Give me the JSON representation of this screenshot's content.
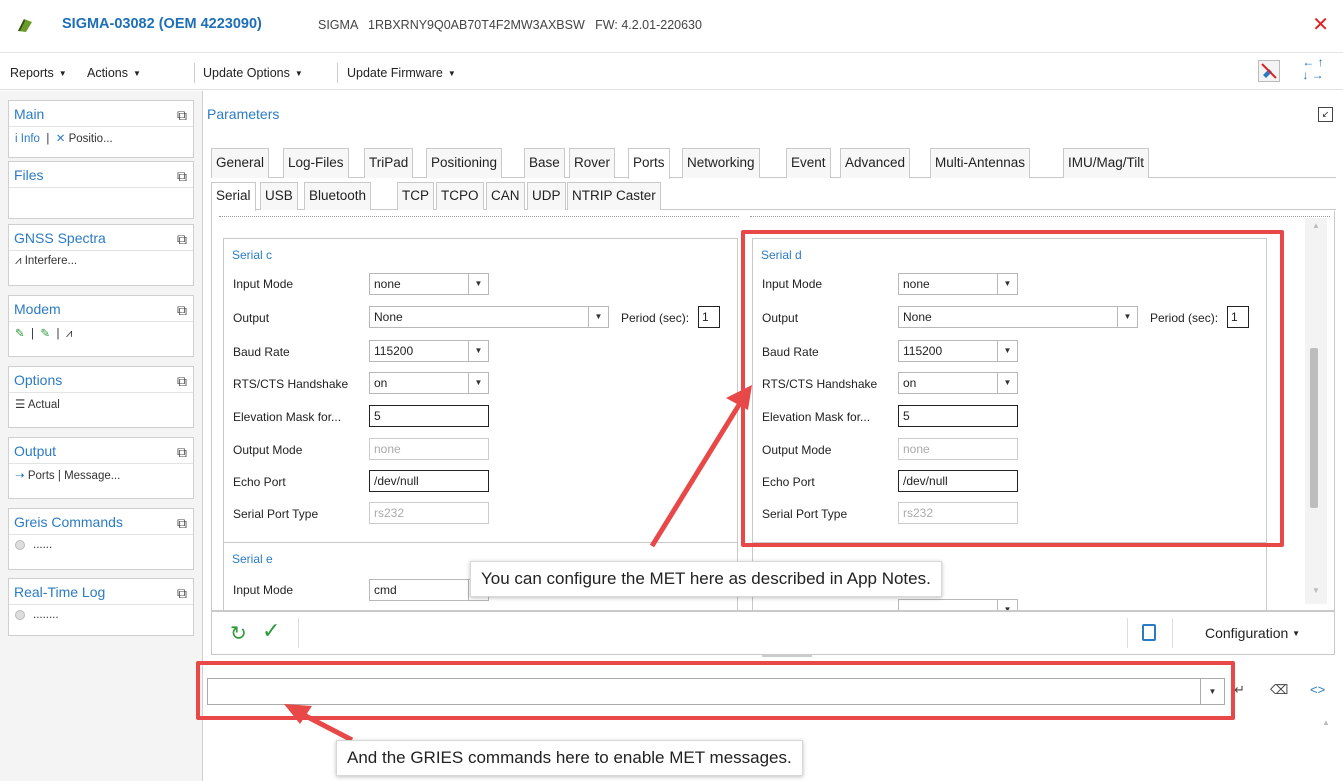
{
  "window": {
    "title_main": "SIGMA-03082 (OEM 4223090)",
    "title_rest": "SIGMA   1RBXRNY9Q0AB70T4F2MW3AXBSW   FW: 4.2.01-220630",
    "close_glyph": "✕"
  },
  "menu": [
    "Reports",
    "Actions",
    "Update Options",
    "Update Firmware"
  ],
  "sidebar": {
    "main": {
      "title": "Main",
      "items": [
        "i Info",
        "Positio..."
      ]
    },
    "files": {
      "title": "Files"
    },
    "gnss": {
      "title": "GNSS Spectra",
      "item": "Interfere..."
    },
    "modem": {
      "title": "Modem"
    },
    "options": {
      "title": "Options",
      "item": "Actual"
    },
    "output": {
      "title": "Output",
      "items": [
        "Ports",
        "Message..."
      ]
    },
    "greis": {
      "title": "Greis Commands",
      "item": "......"
    },
    "rtlog": {
      "title": "Real-Time Log",
      "item": "........"
    }
  },
  "parameters": {
    "title": "Parameters",
    "tabs": [
      "General",
      "Log-Files",
      "TriPad",
      "Positioning",
      "Base",
      "Rover",
      "Ports",
      "Networking",
      "Event",
      "Advanced",
      "Multi-Antennas",
      "IMU/Mag/Tilt"
    ],
    "active_tab": "Ports",
    "subtabs": [
      "Serial",
      "USB",
      "Bluetooth",
      "TCP",
      "TCPO",
      "CAN",
      "UDP",
      "NTRIP Caster"
    ],
    "active_subtab": "Serial"
  },
  "labels": {
    "input_mode": "Input Mode",
    "output": "Output",
    "period": "Period (sec):",
    "baud_rate": "Baud Rate",
    "rts_cts": "RTS/CTS Handshake",
    "elev_mask": "Elevation Mask for...",
    "output_mode": "Output Mode",
    "echo_port": "Echo Port",
    "serial_port_type": "Serial Port Type"
  },
  "serial_c": {
    "title": "Serial c",
    "input_mode": "none",
    "output": "None",
    "period": "1",
    "baud_rate": "115200",
    "rts_cts": "on",
    "elev_mask": "5",
    "output_mode": "none",
    "echo_port": "/dev/null",
    "port_type": "rs232"
  },
  "serial_d": {
    "title": "Serial d",
    "input_mode": "none",
    "output": "None",
    "period": "1",
    "baud_rate": "115200",
    "rts_cts": "on",
    "elev_mask": "5",
    "output_mode": "none",
    "echo_port": "/dev/null",
    "port_type": "rs232"
  },
  "serial_e": {
    "title": "Serial e",
    "input_mode": "cmd"
  },
  "bottom": {
    "configuration": "Configuration"
  },
  "command": {
    "value": "",
    "placeholder": ""
  },
  "annotations": {
    "met_note": "You can configure the MET here as described in App Notes.",
    "gries_note": "And the GRIES commands here to enable MET messages."
  },
  "colors": {
    "accent": "#2b7bc4",
    "callout": "#e84848",
    "ok": "#2e9a3a",
    "close": "#dd2222"
  }
}
